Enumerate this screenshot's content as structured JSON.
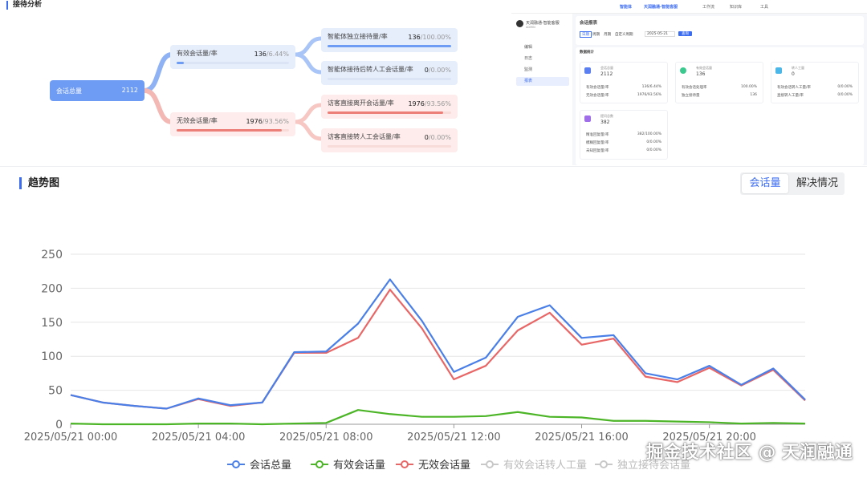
{
  "funnel": {
    "title": "接待分析",
    "root": {
      "label": "会话总量",
      "value": "2112"
    },
    "valid": {
      "label": "有效会话量/率",
      "value": "136",
      "pct": "/6.44%"
    },
    "invalid": {
      "label": "无效会话量/率",
      "value": "1976",
      "pct": "/93.56%"
    },
    "agent_independent": {
      "label": "智能体独立接待量/率",
      "value": "136",
      "pct": "/100.00%"
    },
    "agent_transfer": {
      "label": "智能体接待后转人工会话量/率",
      "value": "0",
      "pct": "/0.00%"
    },
    "visitor_leave": {
      "label": "访客直接离开会话量/率",
      "value": "1976",
      "pct": "/93.56%"
    },
    "visitor_transfer": {
      "label": "访客直接转人工会话量/率",
      "value": "0",
      "pct": "/0.00%"
    },
    "bar_levels": {
      "valid": 0.0644,
      "invalid": 0.9356,
      "agent_independent": 1.0,
      "agent_transfer": 0.0,
      "visitor_leave": 0.9356,
      "visitor_transfer": 0.0
    }
  },
  "mini": {
    "nav": [
      "智能体",
      "天润融通-智能客服",
      "工作流",
      "知识库",
      "工具"
    ],
    "org_name": "天润融通-智能客服",
    "org_sub": "ADMIN",
    "sidebar": [
      "编辑",
      "日志",
      "监测",
      "报表"
    ],
    "report_title": "会话报表",
    "filters": [
      "日期",
      "周期",
      "月期",
      "自定义周期"
    ],
    "date_value": "2025-05-21",
    "query_button": "查询",
    "section_label": "数据统计",
    "stats": [
      {
        "title": "会话总量",
        "value": "2112",
        "rows": [
          [
            "有效会话量/率",
            "136/6.44%"
          ],
          [
            "无效会话量/率",
            "1976/93.56%"
          ]
        ]
      },
      {
        "title": "有效会话量",
        "value": "136",
        "rows": [
          [
            "有效会话处理率",
            "100.00%"
          ],
          [
            "独立接待量",
            "136"
          ]
        ]
      },
      {
        "title": "转人工量",
        "value": "0",
        "rows": [
          [
            "有效会话转人工量/率",
            "0/0.00%"
          ],
          [
            "直接转人工量/率",
            "0/0.00%"
          ]
        ]
      },
      {
        "title": "提问总数",
        "value": "382",
        "rows": [
          [
            "精准回复量/率",
            "382/100.00%"
          ],
          [
            "模糊回复量/率",
            "0/0.00%"
          ],
          [
            "未知回复量/率",
            "0/0.00%"
          ]
        ]
      }
    ]
  },
  "trend": {
    "title": "趋势图",
    "tabs": [
      "会话量",
      "解决情况"
    ],
    "active_tab": 0
  },
  "watermark": "掘金技术社区 @ 天润融通",
  "colors": {
    "accent": "#3c6cf0",
    "blue_series": "#4a7fe8",
    "green_series": "#4cb527",
    "red_series": "#e86666",
    "gray_series": "#c8c8c8"
  },
  "chart_data": {
    "type": "line",
    "title": "",
    "xlabel": "",
    "ylabel": "",
    "ylim": [
      0,
      250
    ],
    "yticks": [
      0,
      50,
      100,
      150,
      200,
      250
    ],
    "x": [
      "2025/05/21 00:00",
      "2025/05/21 01:00",
      "2025/05/21 02:00",
      "2025/05/21 03:00",
      "2025/05/21 04:00",
      "2025/05/21 05:00",
      "2025/05/21 06:00",
      "2025/05/21 07:00",
      "2025/05/21 08:00",
      "2025/05/21 09:00",
      "2025/05/21 10:00",
      "2025/05/21 11:00",
      "2025/05/21 12:00",
      "2025/05/21 13:00",
      "2025/05/21 14:00",
      "2025/05/21 15:00",
      "2025/05/21 16:00",
      "2025/05/21 17:00",
      "2025/05/21 18:00",
      "2025/05/21 19:00",
      "2025/05/21 20:00",
      "2025/05/21 21:00",
      "2025/05/21 22:00",
      "2025/05/21 23:00"
    ],
    "xtick_labels": [
      "2025/05/21 00:00",
      "2025/05/21 04:00",
      "2025/05/21 08:00",
      "2025/05/21 12:00",
      "2025/05/21 16:00",
      "2025/05/21 20:00"
    ],
    "series": [
      {
        "name": "会话总量",
        "color": "#4a7fe8",
        "enabled": true,
        "values": [
          43,
          32,
          27,
          23,
          38,
          28,
          32,
          106,
          107,
          148,
          213,
          152,
          77,
          98,
          158,
          175,
          127,
          131,
          75,
          66,
          86,
          58,
          82,
          36
        ]
      },
      {
        "name": "有效会话量",
        "color": "#4cb527",
        "enabled": true,
        "values": [
          1,
          0,
          0,
          0,
          1,
          1,
          0,
          1,
          2,
          21,
          15,
          11,
          11,
          12,
          18,
          11,
          10,
          5,
          5,
          4,
          3,
          1,
          2,
          1
        ]
      },
      {
        "name": "无效会话量",
        "color": "#e86666",
        "enabled": true,
        "values": [
          43,
          32,
          27,
          23,
          37,
          27,
          32,
          105,
          105,
          127,
          198,
          141,
          66,
          86,
          138,
          164,
          117,
          126,
          70,
          62,
          83,
          57,
          80,
          35
        ]
      },
      {
        "name": "有效会话转人工量",
        "color": "#c8c8c8",
        "enabled": false,
        "values": []
      },
      {
        "name": "独立接待会话量",
        "color": "#c8c8c8",
        "enabled": false,
        "values": []
      }
    ],
    "grid": true,
    "legend": "bottom"
  }
}
